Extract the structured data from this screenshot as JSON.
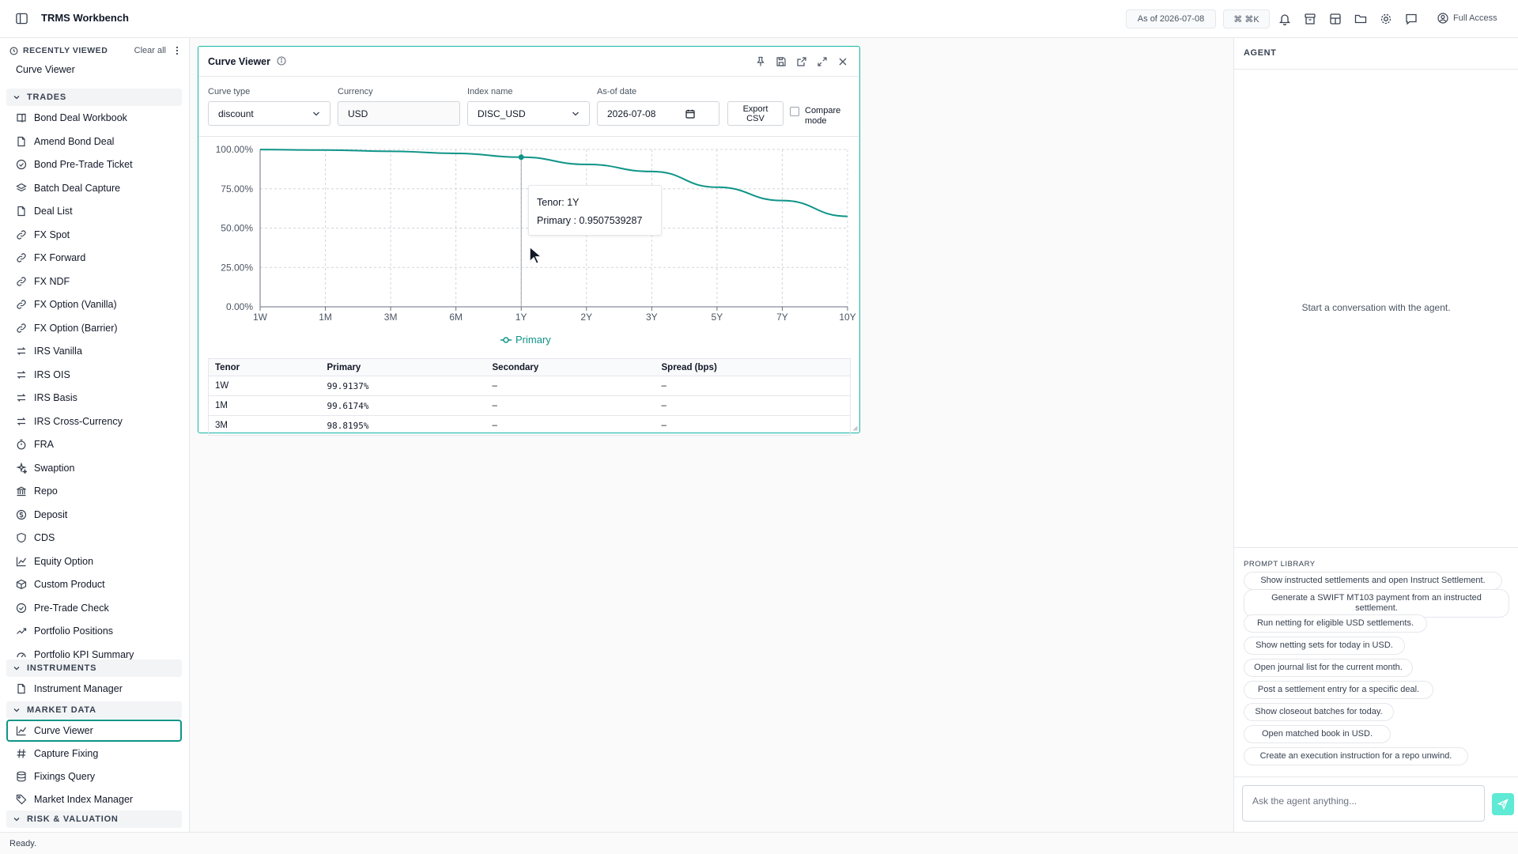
{
  "app": {
    "title": "TRMS Workbench"
  },
  "topbar": {
    "as_of": "As of 2026-07-08",
    "shortcut": "⌘ ⌘K",
    "access": "Full Access"
  },
  "sidebar": {
    "recent_header": "RECENTLY VIEWED",
    "clear_all": "Clear all",
    "recent_items": [
      "Curve Viewer"
    ],
    "sections": {
      "trades": "TRADES",
      "instruments": "INSTRUMENTS",
      "market_data": "MARKET DATA",
      "risk": "RISK & VALUATION"
    },
    "trades": [
      "Bond Deal Workbook",
      "Amend Bond Deal",
      "Bond Pre-Trade Ticket",
      "Batch Deal Capture",
      "Deal List",
      "FX Spot",
      "FX Forward",
      "FX NDF",
      "FX Option (Vanilla)",
      "FX Option (Barrier)",
      "IRS Vanilla",
      "IRS OIS",
      "IRS Basis",
      "IRS Cross-Currency",
      "FRA",
      "Swaption",
      "Repo",
      "Deposit",
      "CDS",
      "Equity Option",
      "Custom Product",
      "Pre-Trade Check",
      "Portfolio Positions",
      "Portfolio KPI Summary"
    ],
    "instruments": [
      "Instrument Manager"
    ],
    "market_data": [
      "Curve Viewer",
      "Capture Fixing",
      "Fixings Query",
      "Market Index Manager"
    ],
    "active_item": "Curve Viewer"
  },
  "panel": {
    "title": "Curve Viewer",
    "controls": {
      "curve_type_label": "Curve type",
      "curve_type_value": "discount",
      "currency_label": "Currency",
      "currency_value": "USD",
      "index_label": "Index name",
      "index_value": "DISC_USD",
      "asof_label": "As-of date",
      "asof_value": "2026-07-08",
      "export_line1": "Export",
      "export_line2": "CSV",
      "compare_line1": "Compare",
      "compare_line2": "mode"
    },
    "tooltip": {
      "tenor": "Tenor: 1Y",
      "value": "Primary : 0.9507539287"
    },
    "table": {
      "headers": [
        "Tenor",
        "Primary",
        "Secondary",
        "Spread (bps)"
      ],
      "rows": [
        [
          "1W",
          "99.9137%",
          "–",
          "–"
        ],
        [
          "1M",
          "99.6174%",
          "–",
          "–"
        ],
        [
          "3M",
          "98.8195%",
          "–",
          "–"
        ]
      ]
    }
  },
  "chart_data": {
    "type": "line",
    "categories": [
      "1W",
      "1M",
      "3M",
      "6M",
      "1Y",
      "2Y",
      "3Y",
      "5Y",
      "7Y",
      "10Y"
    ],
    "series": [
      {
        "name": "Primary",
        "values": [
          0.999137,
          0.996174,
          0.988195,
          0.975,
          0.9507539287,
          0.905,
          0.86,
          0.76,
          0.675,
          0.575
        ]
      }
    ],
    "ylim": [
      0,
      1
    ],
    "yticks": [
      "0.00%",
      "25.00%",
      "50.00%",
      "75.00%",
      "100.00%"
    ],
    "highlight_index": 4,
    "grid": true,
    "legend": "bottom",
    "color": "#0f9488"
  },
  "agent": {
    "header": "AGENT",
    "empty": "Start a conversation with the agent.",
    "prompt_library_title": "PROMPT LIBRARY",
    "prompts": [
      "Show instructed settlements and open Instruct Settlement.",
      "Generate a SWIFT MT103 payment from an instructed settlement.",
      "Run netting for eligible USD settlements.",
      "Show netting sets for today in USD.",
      "Open journal list for the current month.",
      "Post a settlement entry for a specific deal.",
      "Show closeout batches for today.",
      "Open matched book in USD.",
      "Create an execution instruction for a repo unwind."
    ],
    "input_placeholder": "Ask the agent anything..."
  },
  "status": {
    "text": "Ready."
  }
}
